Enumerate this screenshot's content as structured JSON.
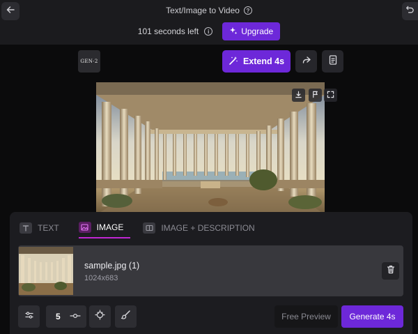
{
  "header": {
    "title": "Text/Image to Video",
    "seconds_left": "101 seconds left",
    "upgrade_label": "Upgrade"
  },
  "model_badge": "GEN-2",
  "actions": {
    "extend_label": "Extend 4s"
  },
  "tabs": [
    {
      "label": "TEXT",
      "active": false
    },
    {
      "label": "IMAGE",
      "active": true
    },
    {
      "label": "IMAGE + DESCRIPTION",
      "active": false
    }
  ],
  "file": {
    "name": "sample.jpg (1)",
    "dimensions": "1024x683"
  },
  "controls": {
    "duration_value": "5",
    "free_preview_label": "Free Preview",
    "generate_label": "Generate 4s"
  },
  "colors": {
    "accent": "#6d28d9",
    "tab_underline": "#c026d3",
    "background": "#0b0b0c",
    "panel": "#1c1c20"
  },
  "icons": {
    "back": "arrow-left-icon",
    "undo": "undo-icon",
    "help": "question-circle-icon",
    "info": "info-circle-icon",
    "upgrade": "sparkle-icon",
    "extend": "magic-wand-icon",
    "share": "share-arrow-icon",
    "notes": "document-icon",
    "download": "download-icon",
    "flag": "flag-icon",
    "fullscreen": "expand-icon",
    "trash": "trash-icon",
    "settings": "sliders-icon",
    "camera_motion": "camera-motion-icon",
    "brush": "brush-icon"
  }
}
